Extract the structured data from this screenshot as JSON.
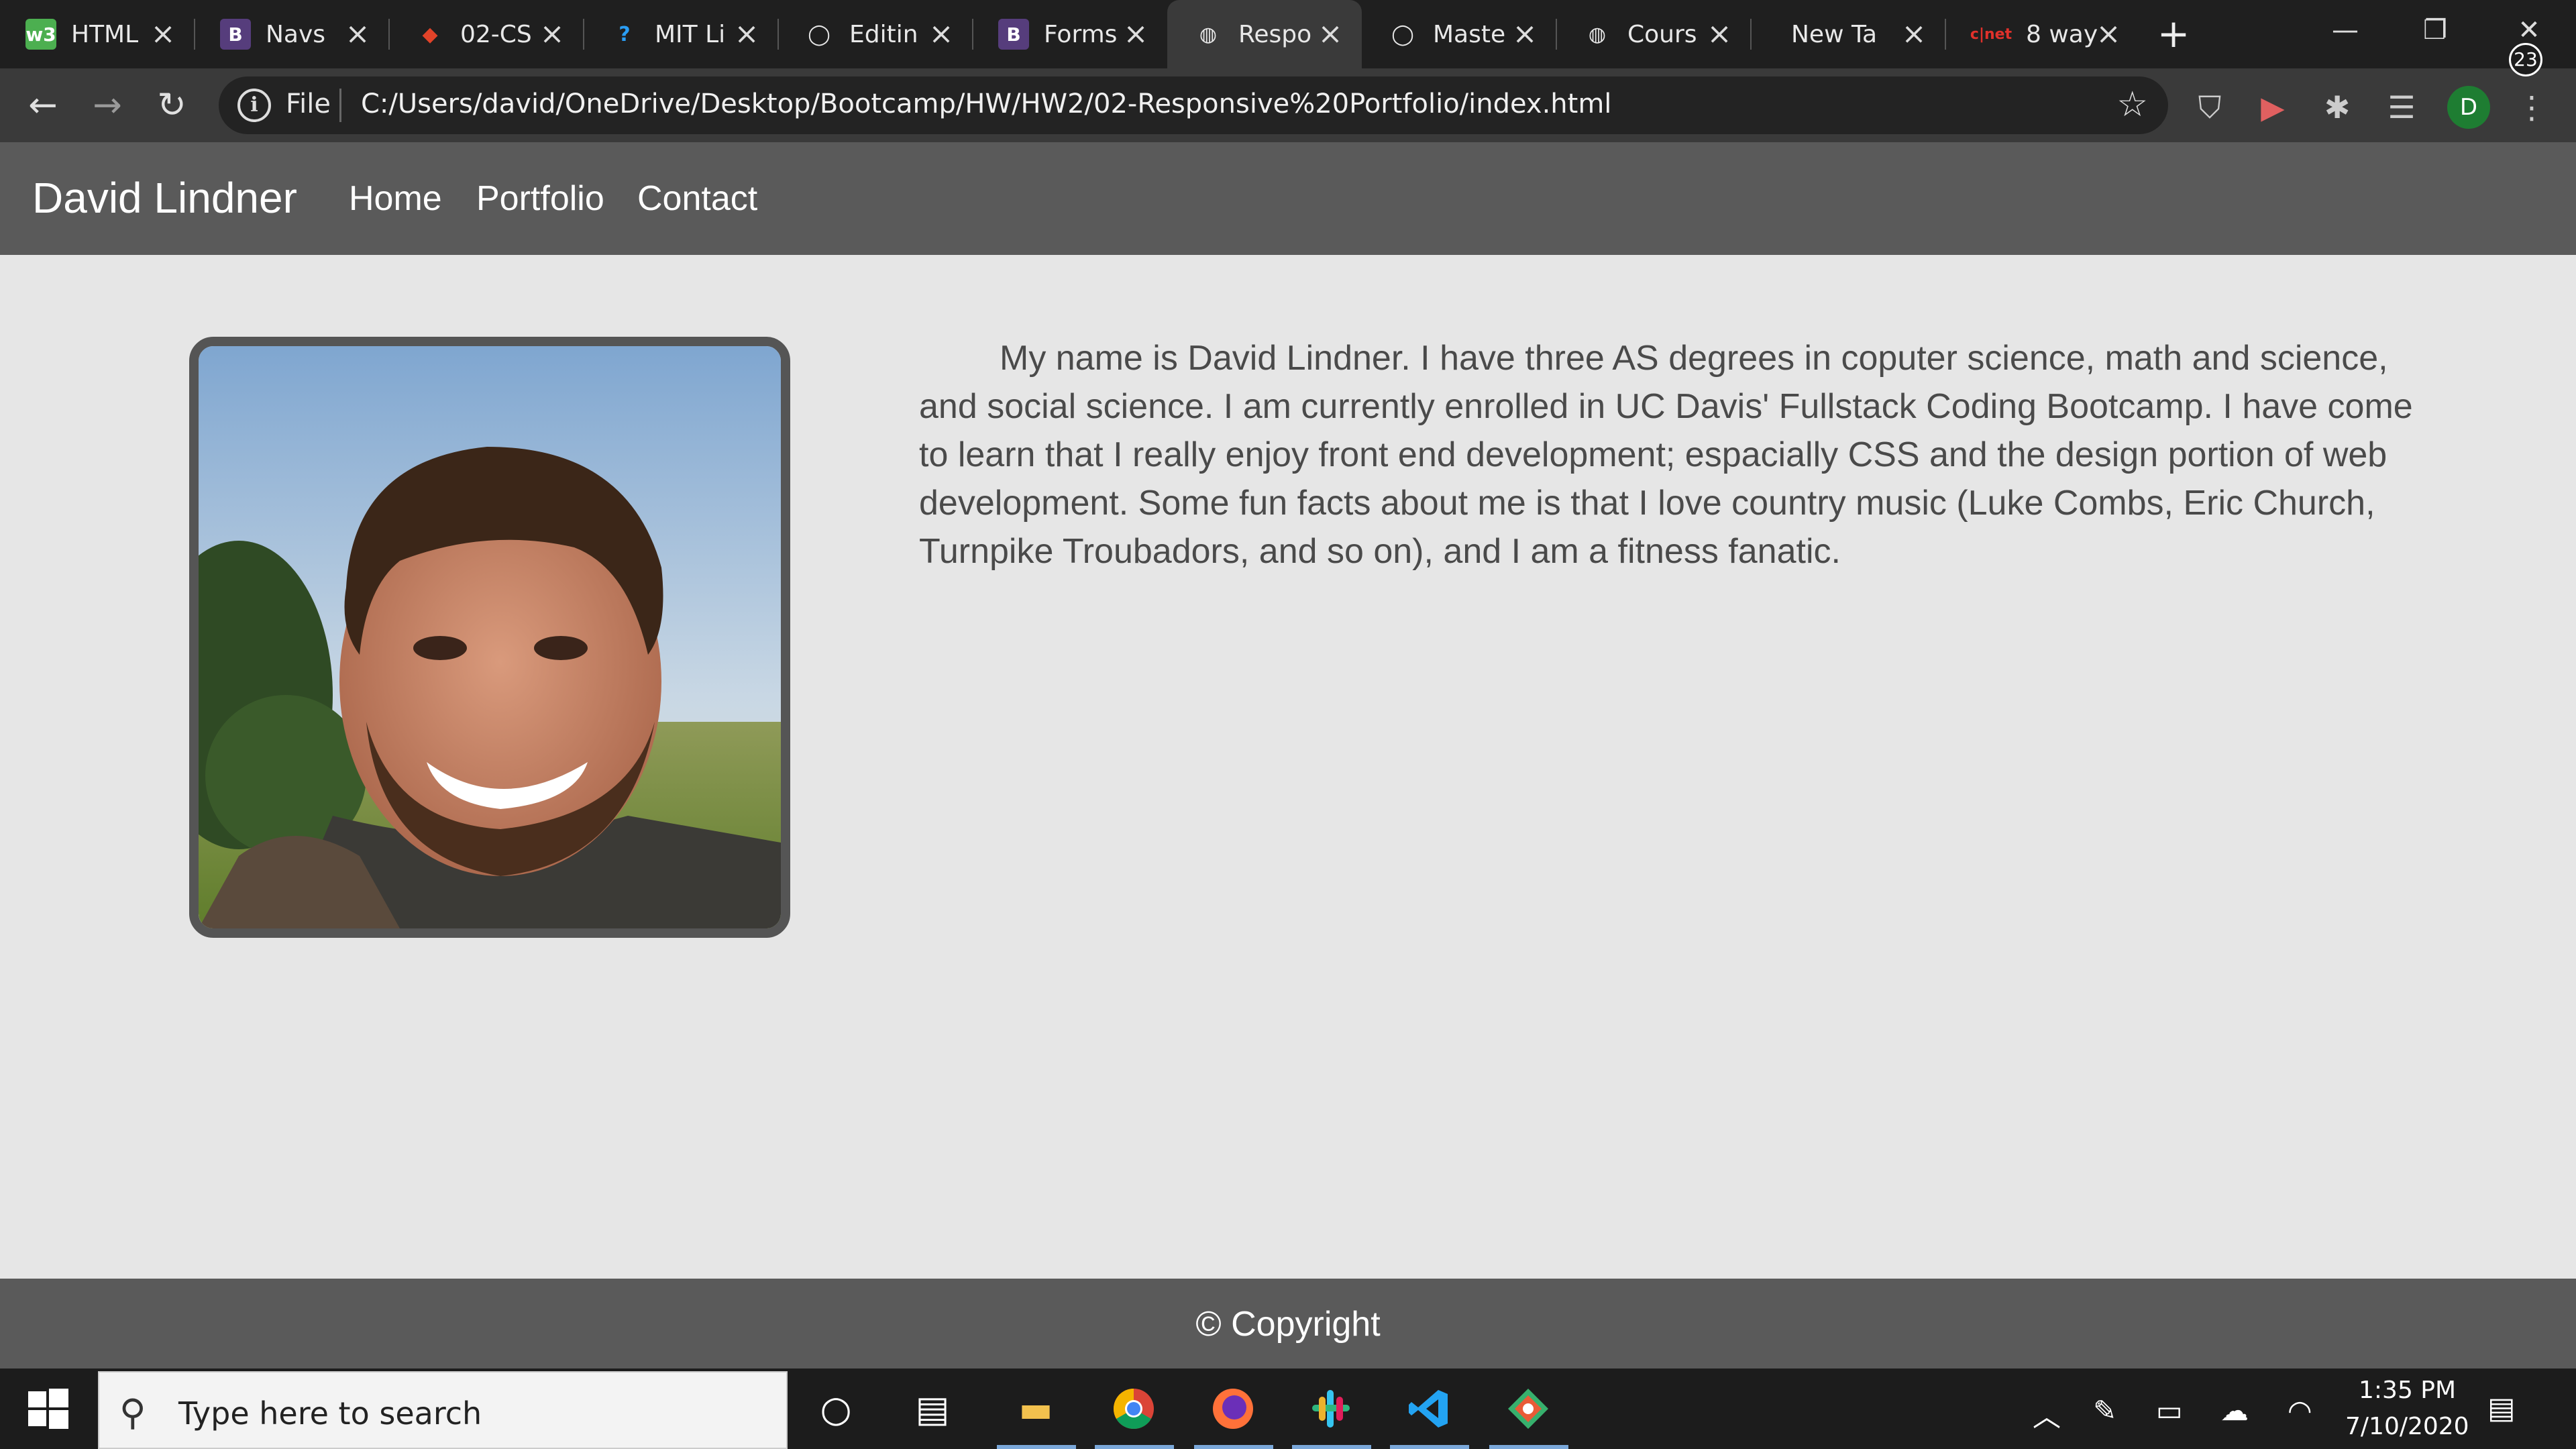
{
  "browser": {
    "tabs": [
      {
        "title": "HTML",
        "icon": "w3-icon",
        "color": "#4caf50",
        "glyph": "w3"
      },
      {
        "title": "Navs",
        "icon": "bootstrap-icon",
        "color": "#563d7c",
        "glyph": "B"
      },
      {
        "title": "02-CS",
        "icon": "gitlab-icon",
        "color": "#e24329",
        "glyph": "◆"
      },
      {
        "title": "MIT Li",
        "icon": "question-icon",
        "color": "#1f1f1f",
        "glyph": "?"
      },
      {
        "title": "Editin",
        "icon": "github-icon",
        "color": "#1f1f1f",
        "glyph": "◯"
      },
      {
        "title": "Forms",
        "icon": "bootstrap-icon",
        "color": "#563d7c",
        "glyph": "B"
      },
      {
        "title": "Respo",
        "icon": "globe-icon",
        "color": "#3a3a3a",
        "glyph": "◍",
        "active": true
      },
      {
        "title": "Maste",
        "icon": "github-icon",
        "color": "#1f1f1f",
        "glyph": "◯"
      },
      {
        "title": "Cours",
        "icon": "globe-icon",
        "color": "#1f1f1f",
        "glyph": "◍"
      },
      {
        "title": "New Tab",
        "icon": "none",
        "color": "#1f1f1f",
        "glyph": ""
      },
      {
        "title": "8 way",
        "icon": "cnet-icon",
        "color": "#1f1f1f",
        "glyph": "c|net"
      }
    ],
    "address": {
      "scheme_label": "File",
      "url": "C:/Users/david/OneDrive/Desktop/Bootcamp/HW/HW2/02-Responsive%20Portfolio/index.html"
    },
    "profile_initial": "D"
  },
  "site": {
    "brand": "David Lindner",
    "nav": [
      "Home",
      "Portfolio",
      "Contact"
    ],
    "bio": "My name is David Lindner. I have three AS degrees in coputer science, math and science, and social science. I am currently enrolled in UC Davis' Fullstack Coding Bootcamp. I have come to learn that I really enjoy front end development; espacially CSS and the design portion of web development. Some fun facts about me is that I love country music (Luke Combs, Eric Church, Turnpike Troubadors, and so on), and I am a fitness fanatic.",
    "footer": "© Copyright"
  },
  "taskbar": {
    "search_placeholder": "Type here to search",
    "time": "1:35 PM",
    "date": "7/10/2020",
    "notifications": "23"
  }
}
